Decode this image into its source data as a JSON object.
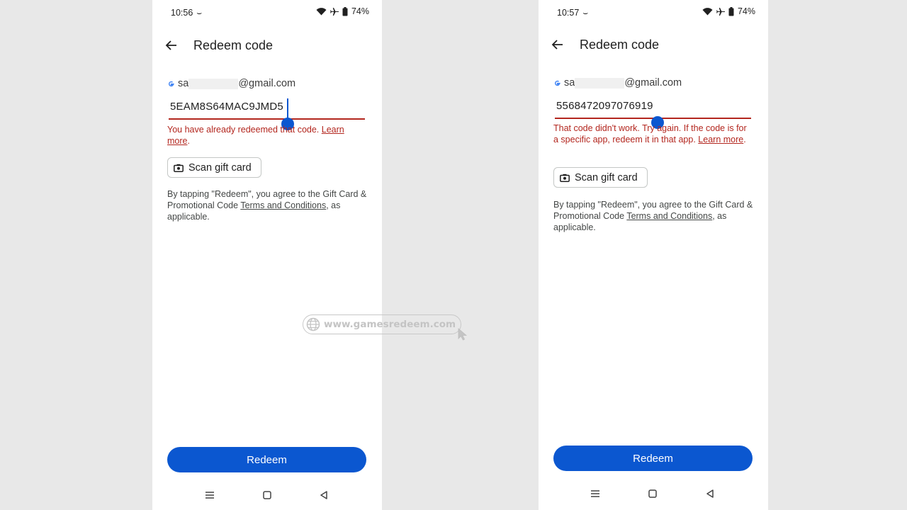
{
  "screens": [
    {
      "status": {
        "time": "10:56",
        "tilde": "⌣",
        "battery": "74%"
      },
      "title": "Redeem code",
      "account": {
        "prefix": "sa",
        "suffix": "@gmail.com"
      },
      "code_value": "5EAM8S64MAC9JMD5",
      "error": {
        "text": "You have already redeemed that code. ",
        "link": "Learn more",
        "end": "."
      },
      "scan_label": "Scan gift card",
      "terms": {
        "pre": "By tapping \"Redeem\", you agree to the Gift Card & Promotional Code ",
        "link": "Terms and Conditions",
        "post": ", as applicable."
      },
      "redeem_label": "Redeem"
    },
    {
      "status": {
        "time": "10:57",
        "tilde": "⌣",
        "battery": "74%"
      },
      "title": "Redeem code",
      "account": {
        "prefix": "sa",
        "suffix": "@gmail.com"
      },
      "code_value": "5568472097076919",
      "error": {
        "text": "That code didn't work. Try again. If the code is for a specific app, redeem it in that app. ",
        "link": "Learn more",
        "end": "."
      },
      "scan_label": "Scan gift card",
      "terms": {
        "pre": "By tapping \"Redeem\", you agree to the Gift Card & Promotional Code ",
        "link": "Terms and Conditions",
        "post": ", as applicable."
      },
      "redeem_label": "Redeem"
    }
  ],
  "watermark": "www.gamesredeem.com",
  "colors": {
    "primary": "#0b57d0",
    "error": "#b3261e",
    "background": "#e8e8e8"
  },
  "icons": [
    "wifi-icon",
    "airplane-icon",
    "battery-icon",
    "back-arrow-icon",
    "google-g-icon",
    "camera-icon",
    "recents-icon",
    "home-icon",
    "back-nav-icon",
    "globe-icon",
    "cursor-icon"
  ]
}
